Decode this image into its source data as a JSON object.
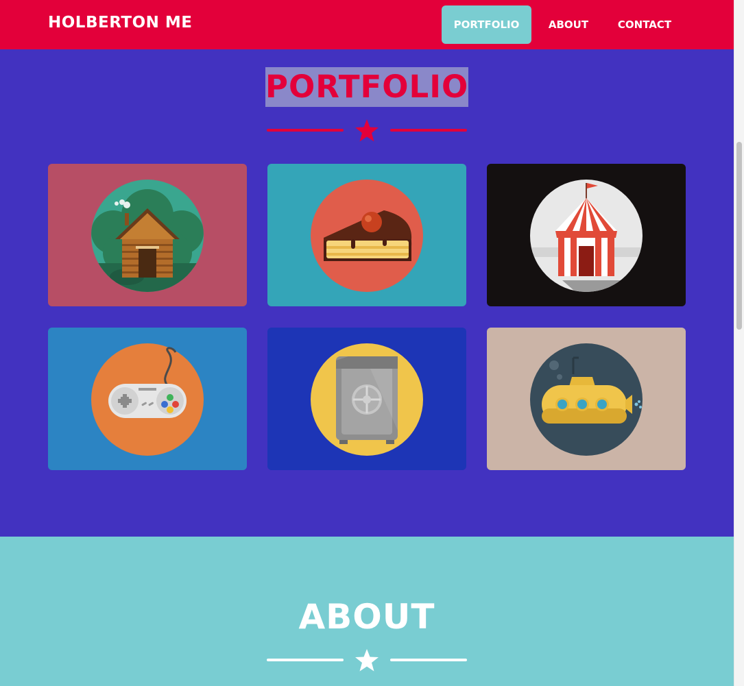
{
  "nav": {
    "brand": "HOLBERTON ME",
    "links": [
      "PORTFOLIO",
      "ABOUT",
      "CONTACT"
    ],
    "active": "PORTFOLIO"
  },
  "portfolio": {
    "title": "PORTFOLIO",
    "items": [
      {
        "icon": "cabin-icon",
        "bg": "#b74e65",
        "circle": "#3aa68f"
      },
      {
        "icon": "cake-icon",
        "bg": "#34a5b8",
        "circle": "#e05d4b"
      },
      {
        "icon": "circus-tent-icon",
        "bg": "#141010",
        "circle": "#e8e8e8"
      },
      {
        "icon": "game-controller-icon",
        "bg": "#2c84c3",
        "circle": "#e57f3c"
      },
      {
        "icon": "safe-icon",
        "bg": "#1d35b6",
        "circle": "#f0c54b"
      },
      {
        "icon": "submarine-icon",
        "bg": "#cbb4a7",
        "circle": "#374c5a"
      }
    ]
  },
  "about": {
    "title": "ABOUT"
  },
  "colors": {
    "primary": "#e3003a",
    "portfolio_bg": "#4232c0",
    "accent": "#7acdd1",
    "white": "#ffffff"
  }
}
